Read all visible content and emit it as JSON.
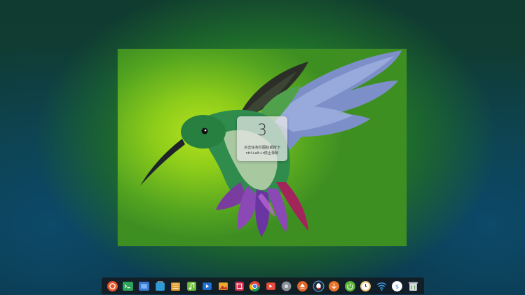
{
  "countdown": {
    "number": "3",
    "hint_line1": "点击任务栏图标或按下",
    "hint_line2": "ctrl+alt+r停止录制"
  },
  "dock": {
    "items": [
      {
        "icon": "launcher-icon"
      },
      {
        "icon": "terminal-icon"
      },
      {
        "icon": "window-manager-icon"
      },
      {
        "icon": "app-store-icon"
      },
      {
        "icon": "file-manager-icon"
      },
      {
        "icon": "music-icon"
      },
      {
        "icon": "video-icon"
      },
      {
        "icon": "image-viewer-icon"
      },
      {
        "icon": "screenshot-icon"
      },
      {
        "icon": "chrome-icon"
      },
      {
        "icon": "screen-recorder-icon"
      },
      {
        "icon": "settings-icon"
      },
      {
        "icon": "eject-icon"
      },
      {
        "icon": "qq-icon"
      },
      {
        "icon": "install-icon"
      },
      {
        "icon": "power-icon"
      },
      {
        "icon": "clock-icon"
      },
      {
        "icon": "wifi-icon"
      },
      {
        "icon": "input-method-icon"
      },
      {
        "icon": "trash-icon"
      }
    ]
  }
}
